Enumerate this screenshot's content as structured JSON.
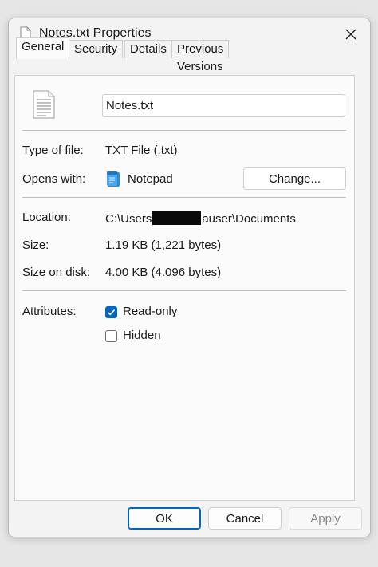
{
  "window": {
    "title": "Notes.txt Properties",
    "close_icon": "close-icon"
  },
  "tabs": [
    {
      "label": "General",
      "active": true
    },
    {
      "label": "Security",
      "active": false
    },
    {
      "label": "Details",
      "active": false
    },
    {
      "label": "Previous Versions",
      "active": false
    }
  ],
  "general": {
    "file_name": "Notes.txt",
    "type_label": "Type of file:",
    "type_value": "TXT File (.txt)",
    "opens_label": "Opens with:",
    "opens_app": "Notepad",
    "change_button": "Change...",
    "location_label": "Location:",
    "location_prefix": "C:\\Users",
    "location_suffix": "auser\\Documents",
    "size_label": "Size:",
    "size_value": "1.19 KB (1,221 bytes)",
    "disk_label": "Size on disk:",
    "disk_value": "4.00 KB (4.096 bytes)",
    "attributes_label": "Attributes:",
    "readonly_label": "Read-only",
    "readonly_checked": true,
    "hidden_label": "Hidden",
    "hidden_checked": false
  },
  "buttons": {
    "ok": "OK",
    "cancel": "Cancel",
    "apply": "Apply"
  },
  "colors": {
    "accent": "#0067c0",
    "redaction": "#0a0a0a"
  }
}
